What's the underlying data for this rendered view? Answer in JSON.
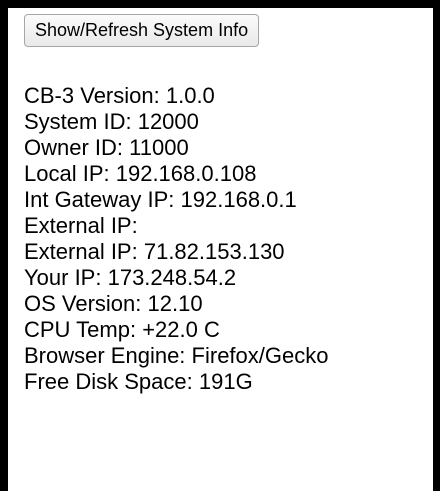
{
  "button": {
    "label": "Show/Refresh System Info"
  },
  "info": [
    {
      "label": "CB-3 Version:",
      "value": "1.0.0"
    },
    {
      "label": "System ID:",
      "value": "12000"
    },
    {
      "label": "Owner ID:",
      "value": "11000"
    },
    {
      "label": "Local IP:",
      "value": "192.168.0.108"
    },
    {
      "label": "Int Gateway IP:",
      "value": "192.168.0.1"
    },
    {
      "label": "External IP:",
      "value": ""
    },
    {
      "label": "External IP:",
      "value": "71.82.153.130"
    },
    {
      "label": "Your IP:",
      "value": "173.248.54.2"
    },
    {
      "label": "OS Version:",
      "value": "12.10"
    },
    {
      "label": "CPU Temp:",
      "value": "+22.0 C"
    },
    {
      "label": "Browser Engine:",
      "value": "Firefox/Gecko"
    },
    {
      "label": "Free Disk Space:",
      "value": "191G"
    }
  ]
}
